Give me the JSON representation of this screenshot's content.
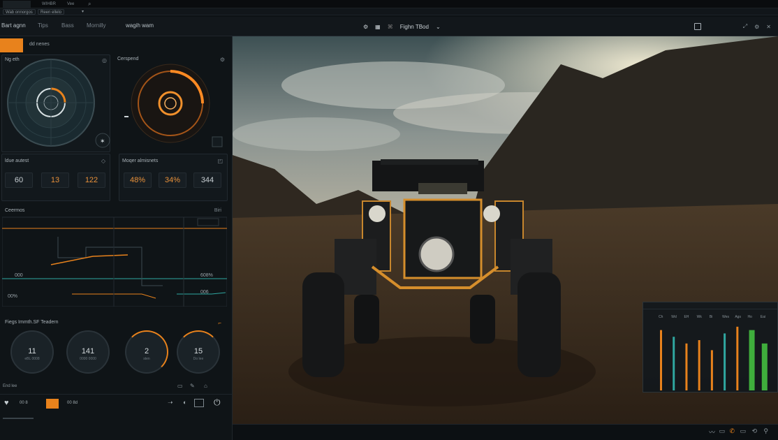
{
  "browser": {
    "tabs": [
      "",
      "WIHBR",
      "",
      "Vee"
    ],
    "address_segments": [
      "Wab onnorgos",
      "Reen ellelo"
    ]
  },
  "app": {
    "menu": [
      "Bart agnn",
      "Tips",
      "Bass",
      "Mornilly",
      "wagih wam"
    ],
    "center_title": "Fighn TBod",
    "orange_tab": "",
    "tab_label": "dd nenes"
  },
  "left": {
    "dial1_title": "Ng eth",
    "dial2_title": "Cerspend",
    "stats1": {
      "title": "ldue autest",
      "values": [
        "60",
        "13",
        "122"
      ]
    },
    "stats2": {
      "title": "Moqer almisnets",
      "values": [
        "48%",
        "34%",
        "344"
      ]
    },
    "graph": {
      "title": "Ceermos",
      "right_label": "Biri",
      "values": [
        "000",
        "00%",
        "608%",
        "006"
      ]
    },
    "gauges": {
      "title": "Fiegs Immth.SF Teadern",
      "values": [
        "11",
        "141",
        "2",
        "15"
      ],
      "subs": [
        "eBL 0008",
        "0000 0000",
        "sten",
        "Do lee"
      ]
    },
    "footer": {
      "label1": "End lee",
      "label2": "00 8",
      "label3": "00 8d"
    }
  },
  "chart_data": {
    "type": "bar",
    "categories": [
      "Ch",
      "Wd",
      "EH",
      "Wk",
      "Bi",
      "Wes",
      "Ags",
      "Ho",
      "Eai"
    ],
    "series": [
      {
        "values": [
          0.9,
          0.8,
          0.7,
          0.75,
          0.6,
          0.85,
          0.95,
          0.9,
          0.7
        ]
      }
    ]
  },
  "colors": {
    "accent": "#e8821c",
    "teal": "#2fa7a0",
    "green": "#3fae3c",
    "panel": "#12181c"
  }
}
